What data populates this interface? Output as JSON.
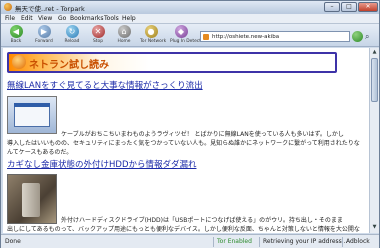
{
  "window": {
    "title": "無天で使..ret - Torpark",
    "min_glyph": "–",
    "max_glyph": "□",
    "close_glyph": "✕"
  },
  "menu": [
    "File",
    "Edit",
    "View",
    "Go",
    "Bookmarks",
    "Tools",
    "Help"
  ],
  "nav": {
    "back": "Back",
    "forward": "Forward",
    "reload": "Reload",
    "stop": "Stop",
    "home": "Home",
    "tor_network": "Tor Network",
    "plugin": "Plug In Detections",
    "url": "http://oshiete.new-akiba",
    "search_glyph": "⌕"
  },
  "site": {
    "name": "ネトラン試し読み"
  },
  "articles": [
    {
      "title": "無線LANをすぐ見てると大事な情報がさっくり流出",
      "text_line1": "ケーブルがおちこちいまわものようラヴィツゼ！ とばかりに無線LANを使っている人も多いはず。しかし",
      "text_rest": "導入したはいいものの、セキュリティにまったく気をつかっていない人も。見知らぬ誰かにネットワークに繋がって利用されたりなんてケースもあるのだ。"
    },
    {
      "title": "カギなし金庫状態の外付けHDDから情報ダダ漏れ",
      "text_line1": "外付けハードディスクドライブ(HDD)は「USBポートにつなげば使える」のがウリ。持ち出し・そのまま",
      "text_rest": "出しにしてあるものって、バックアップ用途にもっとも便利なデバイス。しかし便利な反面、ちゃんと対策しないと情報を大公開なんてことに！"
    }
  ],
  "status": {
    "left": "Done",
    "tor": "Tor Enabled",
    "progress": "Retrieving your IP address...",
    "adblock": "Adblock"
  }
}
